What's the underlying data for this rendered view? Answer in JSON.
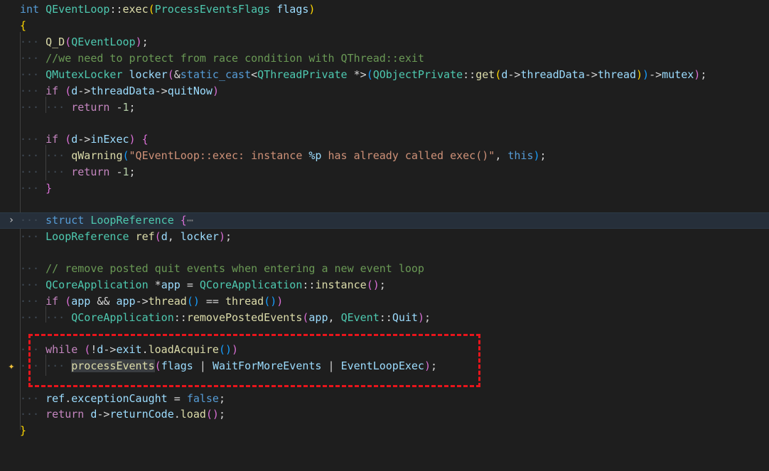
{
  "editor": {
    "language": "cpp",
    "function_signature": "int QEventLoop::exec(ProcessEventsFlags flags)",
    "annotation_color": "#e8141b",
    "lines": [
      "int QEventLoop::exec(ProcessEventsFlags flags)",
      "{",
      "    Q_D(QEventLoop);",
      "    //we need to protect from race condition with QThread::exit",
      "    QMutexLocker locker(&static_cast<QThreadPrivate *>(QObjectPrivate::get(d->threadData->thread))->mutex);",
      "    if (d->threadData->quitNow)",
      "        return -1;",
      "",
      "    if (d->inExec) {",
      "        qWarning(\"QEventLoop::exec: instance %p has already called exec()\", this);",
      "        return -1;",
      "    }",
      "",
      "    struct LoopReference {⋯",
      "    LoopReference ref(d, locker);",
      "",
      "    // remove posted quit events when entering a new event loop",
      "    QCoreApplication *app = QCoreApplication::instance();",
      "    if (app && app->thread() == thread())",
      "        QCoreApplication::removePostedEvents(app, QEvent::Quit);",
      "",
      "    while (!d->exit.loadAcquire())",
      "        processEvents(flags | WaitForMoreEvents | EventLoopExec);",
      "",
      "    ref.exceptionCaught = false;",
      "    return d->returnCode.load();",
      "}"
    ],
    "folded_line_index": 13,
    "collapsed_marker": "⋯",
    "highlighted_line_range": [
      21,
      22
    ]
  }
}
